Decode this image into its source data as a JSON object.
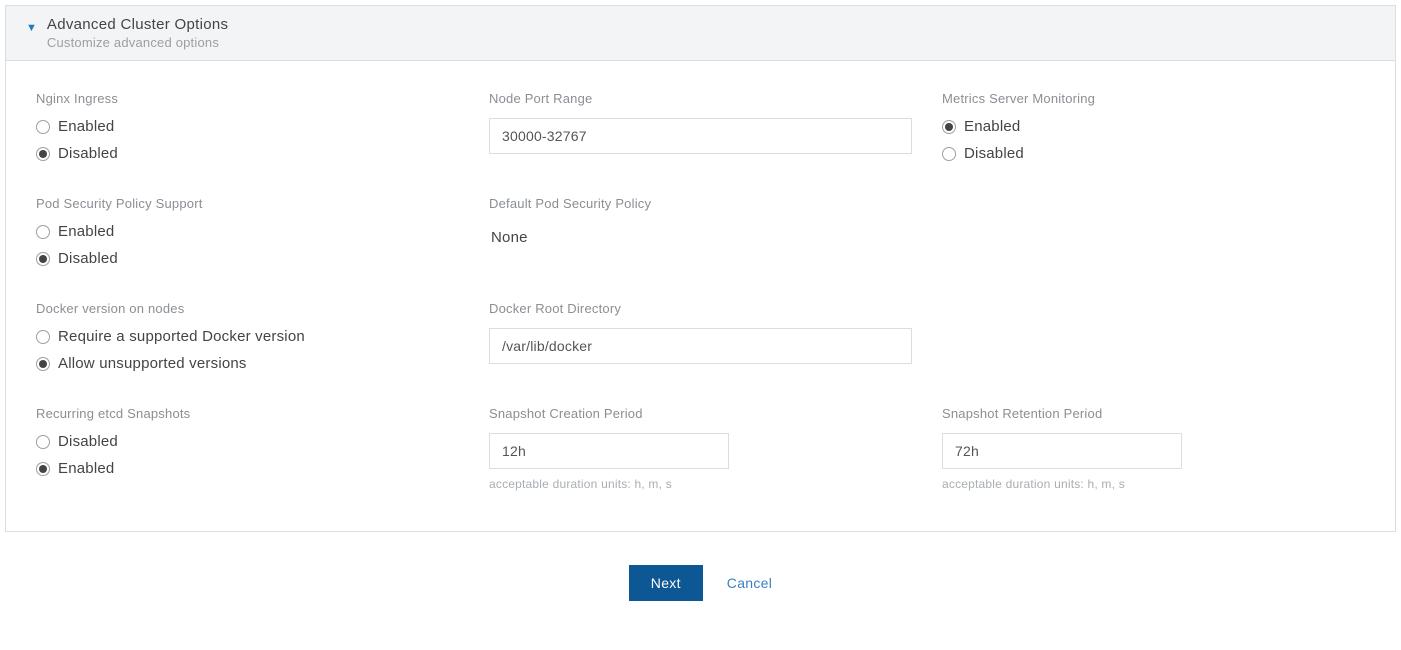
{
  "header": {
    "title": "Advanced Cluster Options",
    "subtitle": "Customize advanced options"
  },
  "labels": {
    "nginx_ingress": "Nginx Ingress",
    "node_port_range": "Node Port Range",
    "metrics_server": "Metrics Server Monitoring",
    "psp_support": "Pod Security Policy Support",
    "default_psp": "Default Pod Security Policy",
    "docker_version": "Docker version on nodes",
    "docker_root": "Docker Root Directory",
    "etcd_snapshots": "Recurring etcd Snapshots",
    "snapshot_creation": "Snapshot Creation Period",
    "snapshot_retention": "Snapshot Retention Period"
  },
  "options": {
    "enabled": "Enabled",
    "disabled": "Disabled",
    "require_docker": "Require a supported Docker version",
    "allow_docker": "Allow unsupported versions"
  },
  "values": {
    "node_port_range": "30000-32767",
    "default_psp": "None",
    "docker_root": "/var/lib/docker",
    "snapshot_creation": "12h",
    "snapshot_retention": "72h"
  },
  "hints": {
    "duration": "acceptable duration units: h, m, s"
  },
  "selected": {
    "nginx_ingress": "disabled",
    "metrics_server": "enabled",
    "psp_support": "disabled",
    "docker_version": "allow",
    "etcd_snapshots": "enabled"
  },
  "actions": {
    "next": "Next",
    "cancel": "Cancel"
  }
}
